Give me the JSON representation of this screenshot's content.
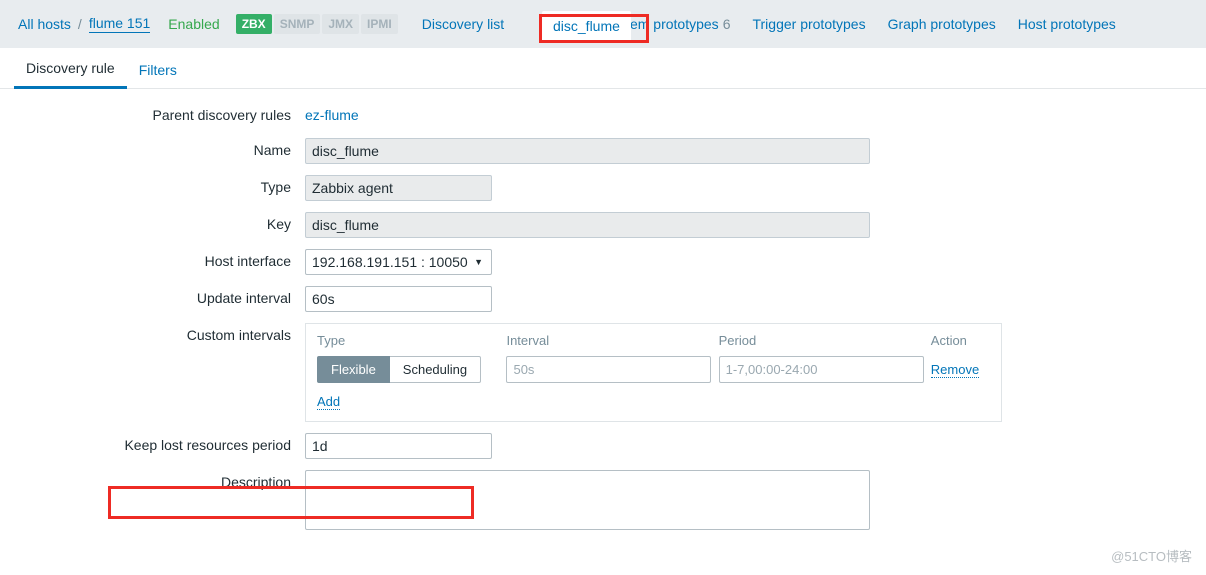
{
  "header": {
    "breadcrumb": {
      "all_hosts": "All hosts",
      "separator": "/",
      "host": "flume 151"
    },
    "status": "Enabled",
    "interfaces": [
      {
        "label": "ZBX",
        "active": true
      },
      {
        "label": "SNMP",
        "active": false
      },
      {
        "label": "JMX",
        "active": false
      },
      {
        "label": "IPMI",
        "active": false
      }
    ],
    "links": [
      {
        "label": "Discovery list",
        "count": ""
      },
      {
        "label": "Item prototypes",
        "count": "6"
      },
      {
        "label": "Trigger prototypes",
        "count": ""
      },
      {
        "label": "Graph prototypes",
        "count": ""
      },
      {
        "label": "Host prototypes",
        "count": ""
      }
    ],
    "selected_tab": "disc_flume"
  },
  "subtabs": [
    {
      "label": "Discovery rule",
      "active": true
    },
    {
      "label": "Filters",
      "active": false
    }
  ],
  "form": {
    "parent_rules": {
      "label": "Parent discovery rules",
      "value": "ez-flume"
    },
    "name": {
      "label": "Name",
      "value": "disc_flume"
    },
    "type": {
      "label": "Type",
      "value": "Zabbix agent"
    },
    "key": {
      "label": "Key",
      "value": "disc_flume"
    },
    "host_interface": {
      "label": "Host interface",
      "value": "192.168.191.151 : 10050",
      "caret": "▼"
    },
    "update_interval": {
      "label": "Update interval",
      "value": "60s"
    },
    "custom_intervals": {
      "label": "Custom intervals",
      "columns": {
        "type": "Type",
        "interval": "Interval",
        "period": "Period",
        "action": "Action"
      },
      "rows": [
        {
          "type_options": [
            {
              "label": "Flexible",
              "selected": true
            },
            {
              "label": "Scheduling",
              "selected": false
            }
          ],
          "interval_value": "",
          "interval_placeholder": "50s",
          "period_value": "",
          "period_placeholder": "1-7,00:00-24:00",
          "action": "Remove"
        }
      ],
      "add_label": "Add"
    },
    "keep_lost": {
      "label": "Keep lost resources period",
      "value": "1d"
    },
    "description": {
      "label": "Description",
      "value": "",
      "placeholder": ""
    }
  },
  "watermark": "@51CTO博客",
  "colors": {
    "accent_link": "#0275b8",
    "status_green": "#36a84e",
    "badge_green": "#34af67",
    "annotation_red": "#ee2b24",
    "header_band": "#e8ecef",
    "segment_selected": "#768d99"
  }
}
